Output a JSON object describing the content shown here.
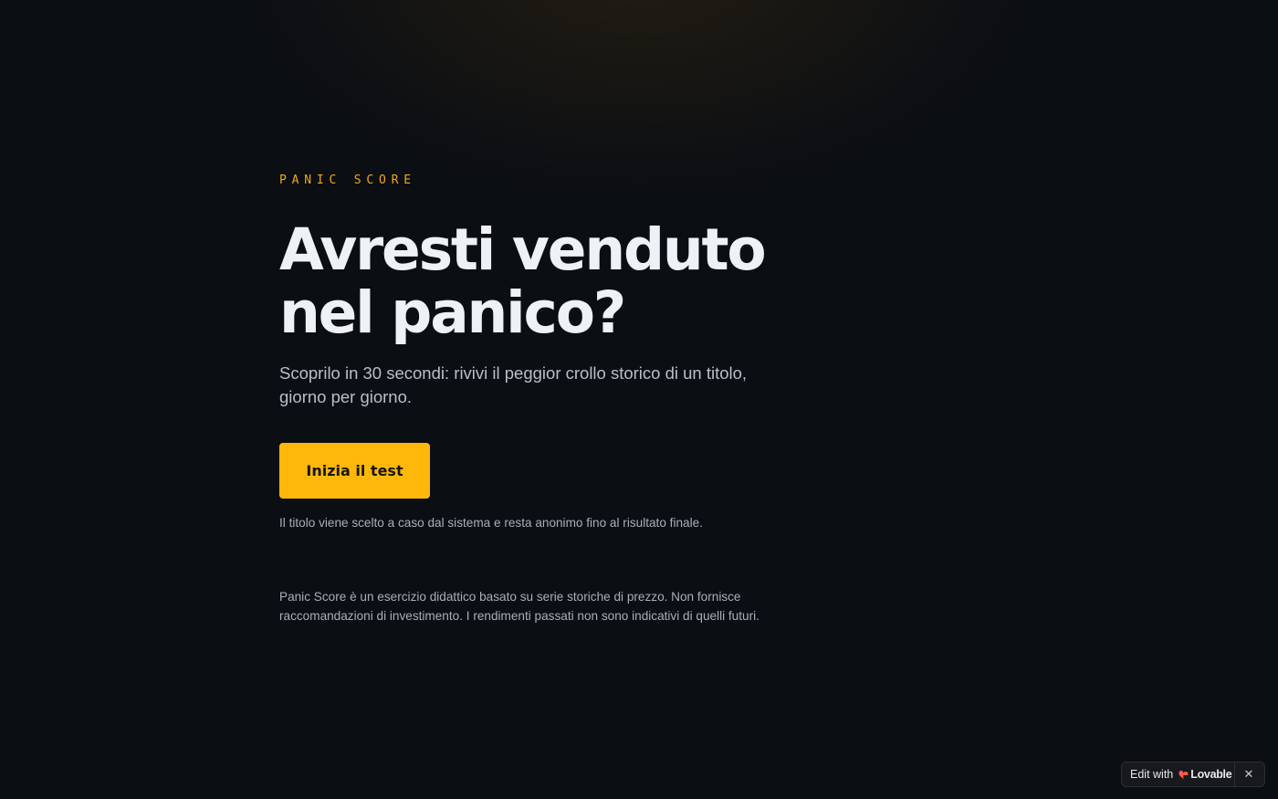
{
  "hero": {
    "eyebrow": "PANIC SCORE",
    "headline_line1": "Avresti venduto",
    "headline_line2": "nel panico?",
    "subtitle": "Scoprilo in 30 secondi: rivivi il peggior crollo storico di un titolo, giorno per giorno.",
    "cta_label": "Inizia il test",
    "note": "Il titolo viene scelto a caso dal sistema e resta anonimo fino al risultato finale."
  },
  "footer": {
    "disclaimer": "Panic Score è un esercizio didattico basato su serie storiche di prezzo. Non fornisce raccomandazioni di investimento. I rendimenti passati non sono indicativi di quelli futuri."
  },
  "badge": {
    "edit_label": "Edit with",
    "brand_label": "Lovable",
    "logo_icon": "lovable-heart-icon",
    "close_icon": "close-icon",
    "close_glyph": "✕"
  },
  "colors": {
    "background": "#0b0e13",
    "accent": "#ffb80a",
    "eyebrow": "#f0a816",
    "headline": "#eef1f5",
    "body_text": "#b9bfc9"
  }
}
